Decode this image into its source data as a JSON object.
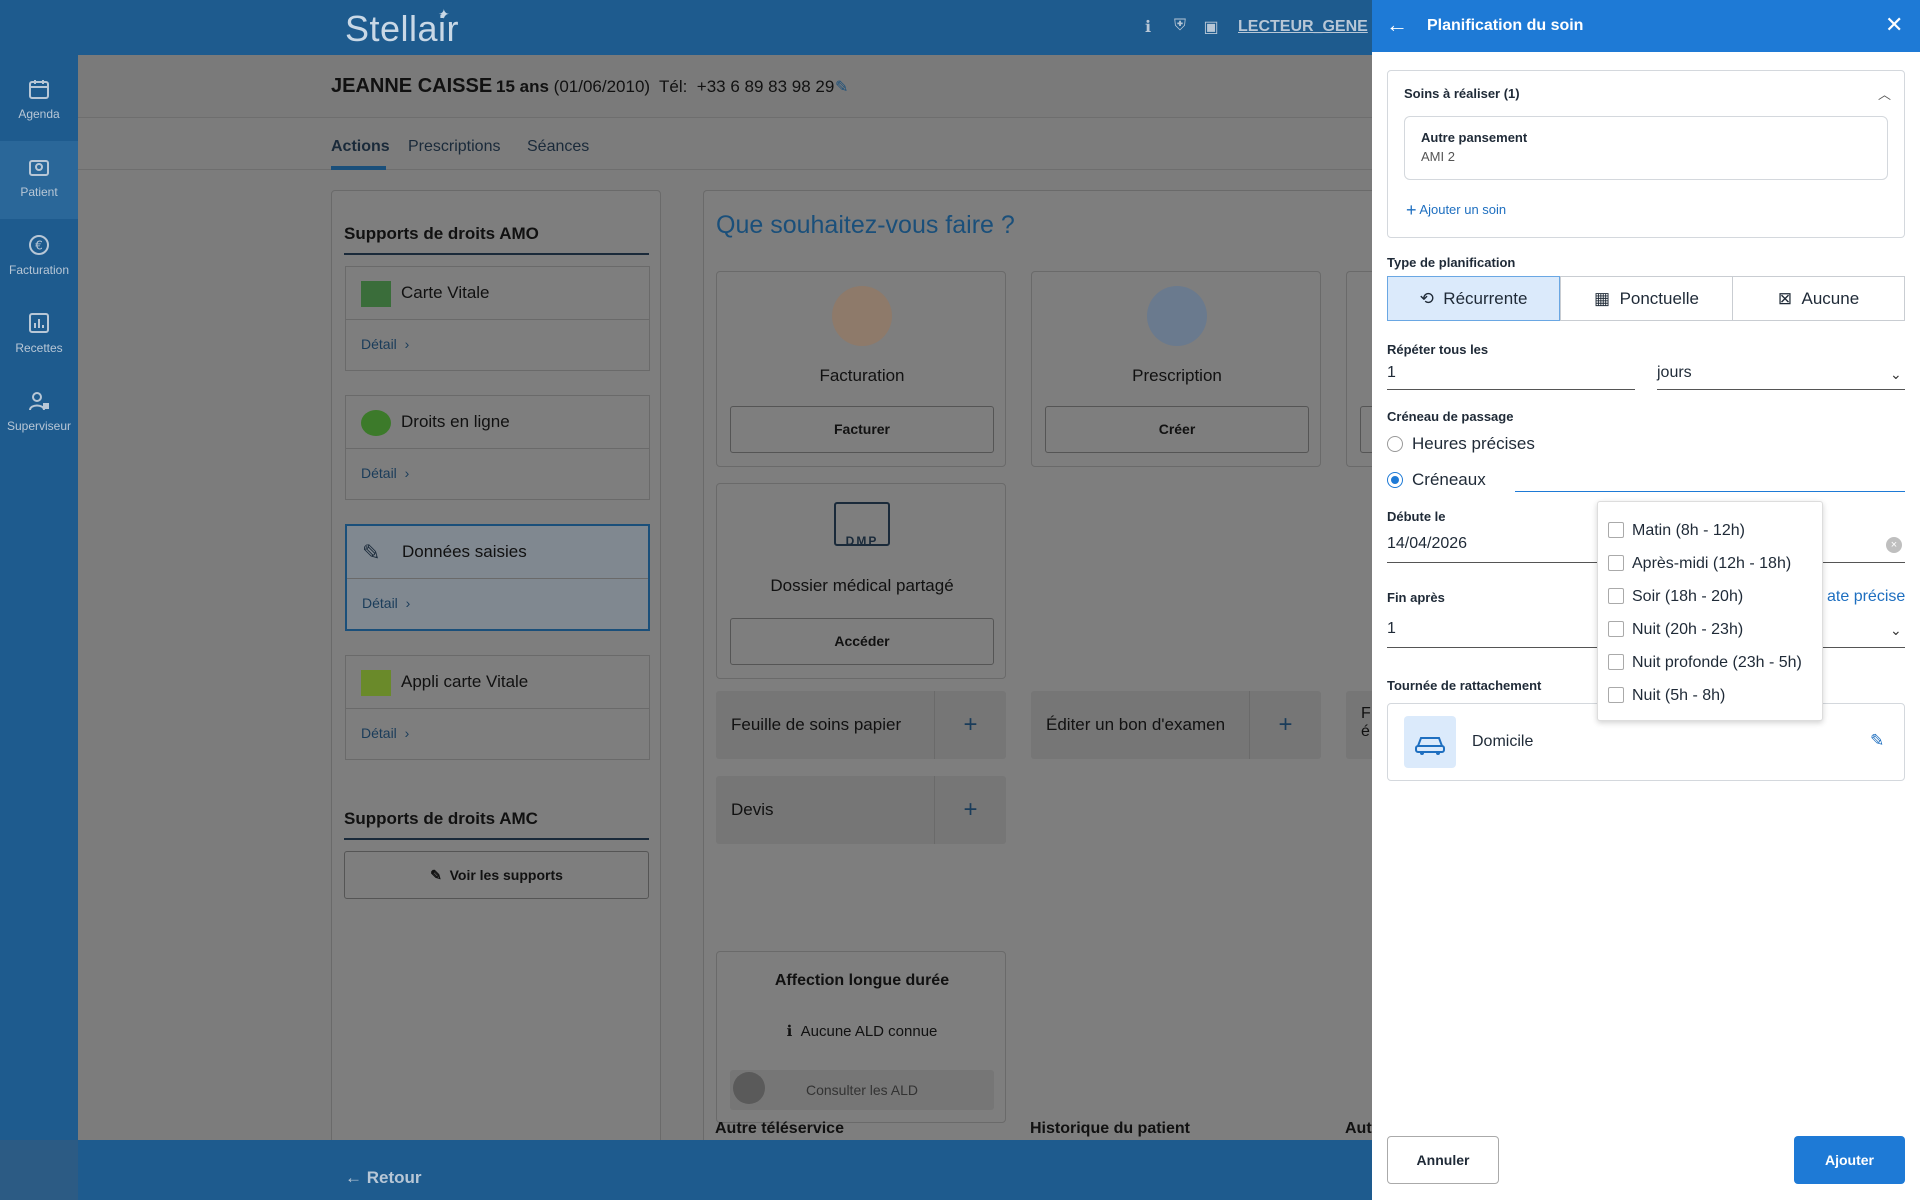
{
  "app": {
    "logo": "Stellair",
    "reader": "LECTEUR_GENE"
  },
  "rail": [
    {
      "label": "Agenda",
      "icon": "calendar-icon"
    },
    {
      "label": "Patient",
      "icon": "patient-icon"
    },
    {
      "label": "Facturation",
      "icon": "euro-icon"
    },
    {
      "label": "Recettes",
      "icon": "chart-icon"
    },
    {
      "label": "Superviseur",
      "icon": "supervisor-icon"
    }
  ],
  "patient": {
    "name": "JEANNE CAISSE",
    "age": "15 ans",
    "birth": "(01/06/2010)",
    "tel_label": "Tél:",
    "tel": "+33 6 89 83 98 29"
  },
  "tabs": [
    "Actions",
    "Prescriptions",
    "Séances"
  ],
  "amo": {
    "title": "Supports de droits AMO",
    "items": [
      {
        "title": "Carte Vitale",
        "detail": "Détail"
      },
      {
        "title": "Droits en ligne",
        "detail": "Détail"
      },
      {
        "title": "Données saisies",
        "detail": "Détail"
      },
      {
        "title": "Appli carte Vitale",
        "detail": "Détail"
      }
    ]
  },
  "amc": {
    "title": "Supports de droits AMC",
    "button": "Voir les supports"
  },
  "actions": {
    "title": "Que souhaitez-vous faire ?",
    "cards": [
      {
        "title": "Facturation",
        "button": "Facturer"
      },
      {
        "title": "Prescription",
        "button": "Créer"
      },
      {
        "title": "Dossier médical partagé",
        "button": "Accéder",
        "logo_text": "DMP"
      }
    ],
    "plus_items": [
      "Feuille de soins papier",
      "Éditer un bon d'examen",
      "Devis"
    ],
    "partial_text": "F\né",
    "ald": {
      "title": "Affection longue durée",
      "none": "Aucune ALD connue",
      "button": "Consulter les ALD"
    },
    "bottom_labels": [
      "Autre téléservice",
      "Historique du patient",
      "Aut"
    ]
  },
  "back": "Retour",
  "panel": {
    "title": "Planification du soin",
    "soins_title": "Soins à réaliser (1)",
    "soin": {
      "name": "Autre pansement",
      "code": "AMI 2"
    },
    "add_soin": "Ajouter un soin",
    "type_label": "Type de planification",
    "types": [
      "Récurrente",
      "Ponctuelle",
      "Aucune"
    ],
    "repeat_label": "Répéter tous les",
    "repeat_value": "1",
    "repeat_unit": "jours",
    "creneau_label": "Créneau de passage",
    "radio_options": [
      "Heures précises",
      "Créneaux"
    ],
    "debute_label": "Débute le",
    "debute_value": "14/04/2026",
    "fin_label": "Fin après",
    "fin_value": "1",
    "fin_link": "ate précise",
    "tournee_label": "Tournée de rattachement",
    "tournee_value": "Domicile",
    "slots": [
      "Matin (8h - 12h)",
      "Après-midi (12h - 18h)",
      "Soir (18h - 20h)",
      "Nuit (20h - 23h)",
      "Nuit profonde (23h - 5h)",
      "Nuit (5h - 8h)"
    ],
    "cancel": "Annuler",
    "add": "Ajouter"
  }
}
